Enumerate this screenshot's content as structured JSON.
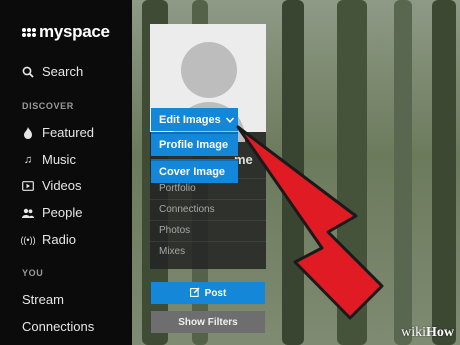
{
  "sidebar": {
    "logo": "myspace",
    "search": "Search",
    "discover_heading": "DISCOVER",
    "discover_items": [
      {
        "label": "Featured",
        "icon": "flame-icon"
      },
      {
        "label": "Music",
        "icon": "music-note-icon"
      },
      {
        "label": "Videos",
        "icon": "video-icon"
      },
      {
        "label": "People",
        "icon": "people-icon"
      },
      {
        "label": "Radio",
        "icon": "radio-icon"
      }
    ],
    "you_heading": "YOU",
    "you_items": [
      "Stream",
      "Connections"
    ]
  },
  "profile_card": {
    "name_peek": "me",
    "links": [
      "Portfolio",
      "Connections",
      "Photos",
      "Mixes"
    ]
  },
  "dropdown": {
    "button_label": "Edit Images",
    "options": [
      "Profile Image",
      "Cover Image"
    ]
  },
  "actions": {
    "post_label": "Post",
    "filters_label": "Show Filters"
  },
  "watermark": {
    "prefix": "wiki",
    "suffix": "How"
  },
  "colors": {
    "accent": "#1487d8",
    "arrow": "#e01b24",
    "sidebar": "#0b0b0b"
  }
}
